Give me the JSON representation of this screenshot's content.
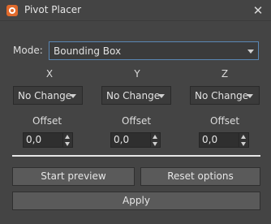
{
  "window": {
    "title": "Pivot Placer",
    "close_glyph": "✕",
    "app_icon": "pivot-placer-icon"
  },
  "mode": {
    "label": "Mode:",
    "value": "Bounding Box"
  },
  "axes": [
    {
      "name": "X",
      "value": "No Change",
      "offset_label": "Offset",
      "offset_value": "0,0"
    },
    {
      "name": "Y",
      "value": "No Change",
      "offset_label": "Offset",
      "offset_value": "0,0"
    },
    {
      "name": "Z",
      "value": "No Change",
      "offset_label": "Offset",
      "offset_value": "0,0"
    }
  ],
  "buttons": {
    "start_preview": "Start preview",
    "reset_options": "Reset options",
    "apply": "Apply"
  }
}
